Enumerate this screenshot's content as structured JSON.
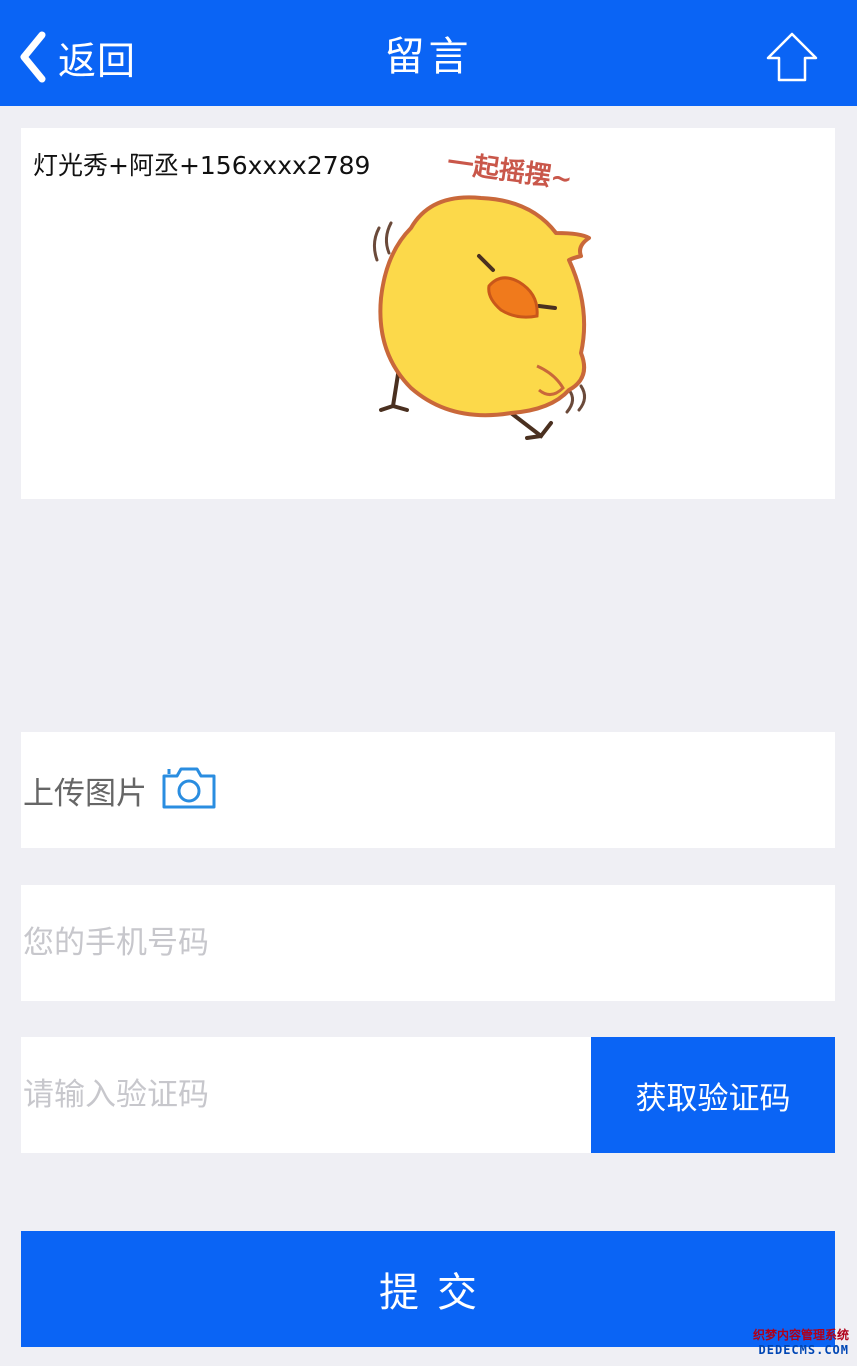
{
  "nav": {
    "back_label": "返回",
    "title": "留言",
    "back_icon": "chevron-left-icon",
    "home_icon": "home-icon"
  },
  "message": {
    "text": "灯光秀+阿丞+156xxxx2789",
    "sticker_caption": "一起摇摆~"
  },
  "upload": {
    "label": "上传图片",
    "icon": "camera-icon"
  },
  "phone": {
    "placeholder": "您的手机号码",
    "value": ""
  },
  "verify": {
    "placeholder": "请输入验证码",
    "value": "",
    "button_label": "获取验证码"
  },
  "submit": {
    "label": "提交"
  },
  "watermark": {
    "line1": "织梦内容管理系统",
    "line2": "DEDECMS.COM"
  },
  "colors": {
    "primary": "#0a64f5",
    "background": "#efeff4",
    "card": "#ffffff",
    "placeholder": "#c7c7cc",
    "icon_blue": "#2a8de0"
  }
}
